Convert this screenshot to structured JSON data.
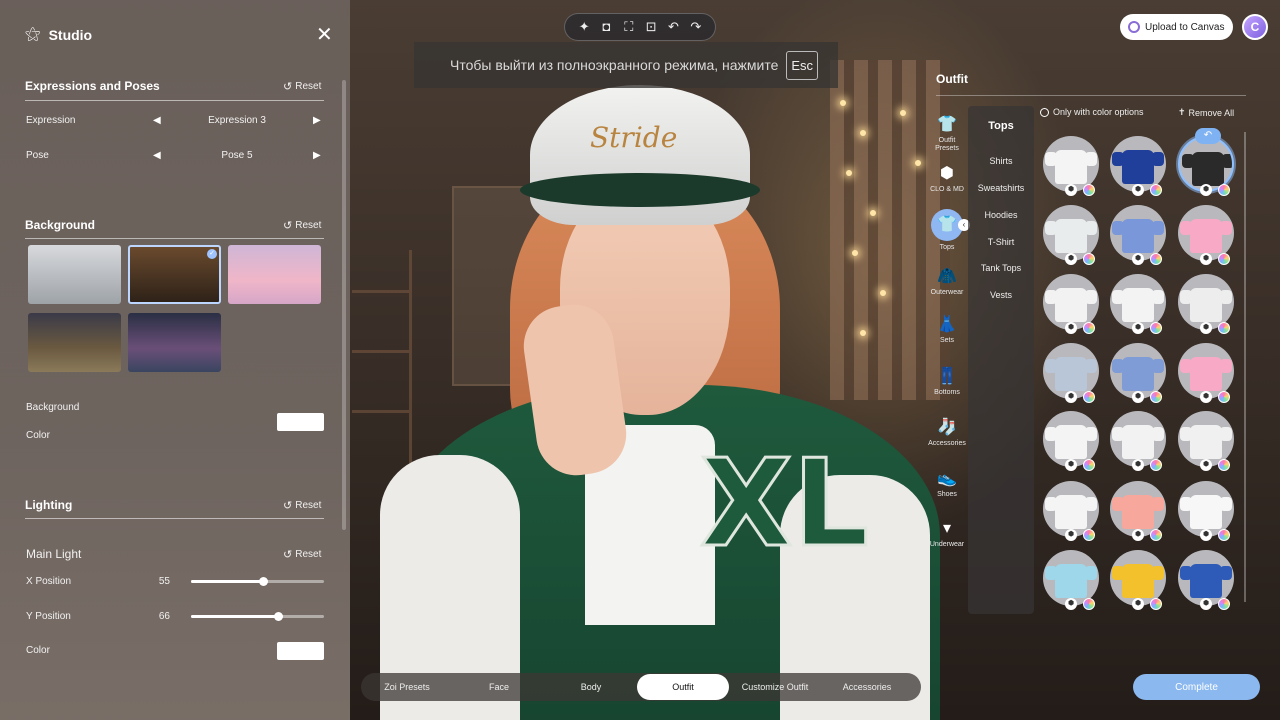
{
  "studio": {
    "title": "Studio",
    "expressions": {
      "title": "Expressions and Poses",
      "reset": "Reset",
      "expression_label": "Expression",
      "expression_value": "Expression 3",
      "pose_label": "Pose",
      "pose_value": "Pose 5"
    },
    "background": {
      "title": "Background",
      "reset": "Reset",
      "color_label_1": "Background",
      "color_label_2": "Color",
      "color": "#ffffff"
    },
    "lighting": {
      "title": "Lighting",
      "reset": "Reset",
      "main_light": "Main Light",
      "main_reset": "Reset",
      "x_label": "X Position",
      "x_value": "55",
      "y_label": "Y Position",
      "y_value": "66",
      "color_label": "Color",
      "color": "#ffffff"
    }
  },
  "toast": {
    "message": "Чтобы выйти из полноэкранного режима, нажмите",
    "key": "Esc"
  },
  "topbar": {
    "upload": "Upload to Canvas",
    "avatar_initial": "C"
  },
  "bottom_nav": {
    "tabs": [
      {
        "label": "Zoi Presets"
      },
      {
        "label": "Face"
      },
      {
        "label": "Body"
      },
      {
        "label": "Outfit"
      },
      {
        "label": "Customize Outfit"
      },
      {
        "label": "Accessories"
      }
    ],
    "active": "Outfit"
  },
  "complete": "Complete",
  "outfit": {
    "title": "Outfit",
    "only_color": "Only with color options",
    "remove_all": "Remove All",
    "categories": [
      {
        "label": "Outfit Presets"
      },
      {
        "label": "CLO & MD"
      },
      {
        "label": "Tops"
      },
      {
        "label": "Outerwear"
      },
      {
        "label": "Sets"
      },
      {
        "label": "Bottoms"
      },
      {
        "label": "Accessories"
      },
      {
        "label": "Shoes"
      },
      {
        "label": "Underwear"
      }
    ],
    "subcategories": [
      {
        "label": "Tops"
      },
      {
        "label": "Shirts"
      },
      {
        "label": "Sweatshirts"
      },
      {
        "label": "Hoodies"
      },
      {
        "label": "T-Shirt"
      },
      {
        "label": "Tank Tops"
      },
      {
        "label": "Vests"
      }
    ]
  },
  "character": {
    "cap_text": "Stride",
    "jacket_text": "XL"
  },
  "colors": {
    "accent": "#8ab8ef",
    "panel": "#6e645f"
  }
}
